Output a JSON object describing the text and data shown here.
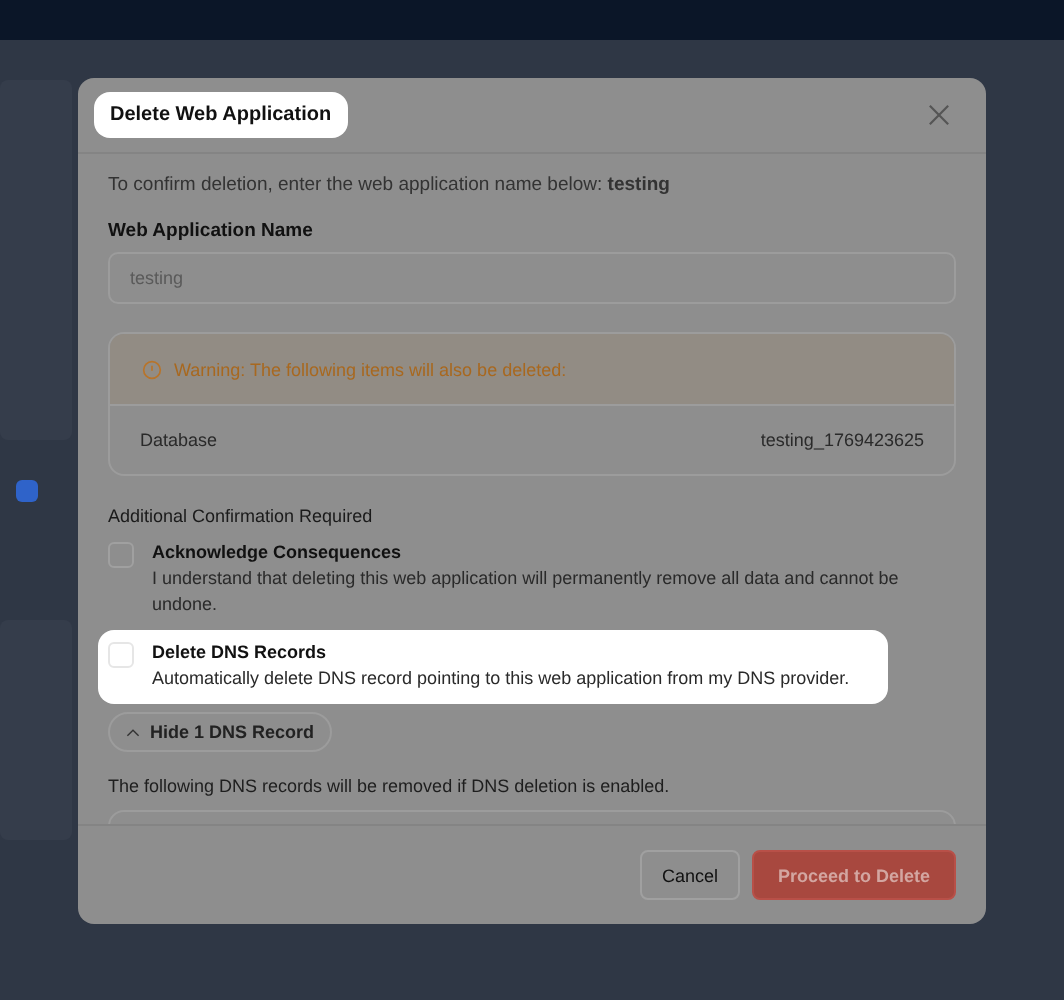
{
  "dialog": {
    "title": "Delete Web Application",
    "title_highlighted": true,
    "intro": "To confirm deletion, enter the web application name below: **testing**",
    "field_label": "Web Application Name",
    "field_placeholder": "testing",
    "warning": {
      "message": "Warning: The following items will also be deleted:",
      "items": [
        {
          "label": "Database",
          "value": "testing_1769423625"
        }
      ]
    },
    "confirm_heading": "Additional Confirmation Required",
    "options": [
      {
        "title": "Acknowledge Consequences",
        "description": "I understand that deleting this web application will permanently remove all data and cannot be undone.",
        "checked": false,
        "highlighted": false
      },
      {
        "title": "Delete DNS Records",
        "description": "Automatically delete DNS record pointing to this web application from my DNS provider.",
        "checked": false,
        "highlighted": true
      }
    ],
    "toggle": {
      "label": "Hide 1 DNS Record",
      "expanded": true
    },
    "dns_note": "The following DNS records will be removed if DNS deletion is enabled.",
    "buttons": [
      {
        "label": "Cancel",
        "kind": "secondary"
      },
      {
        "label": "Proceed to Delete",
        "kind": "danger"
      }
    ]
  }
}
